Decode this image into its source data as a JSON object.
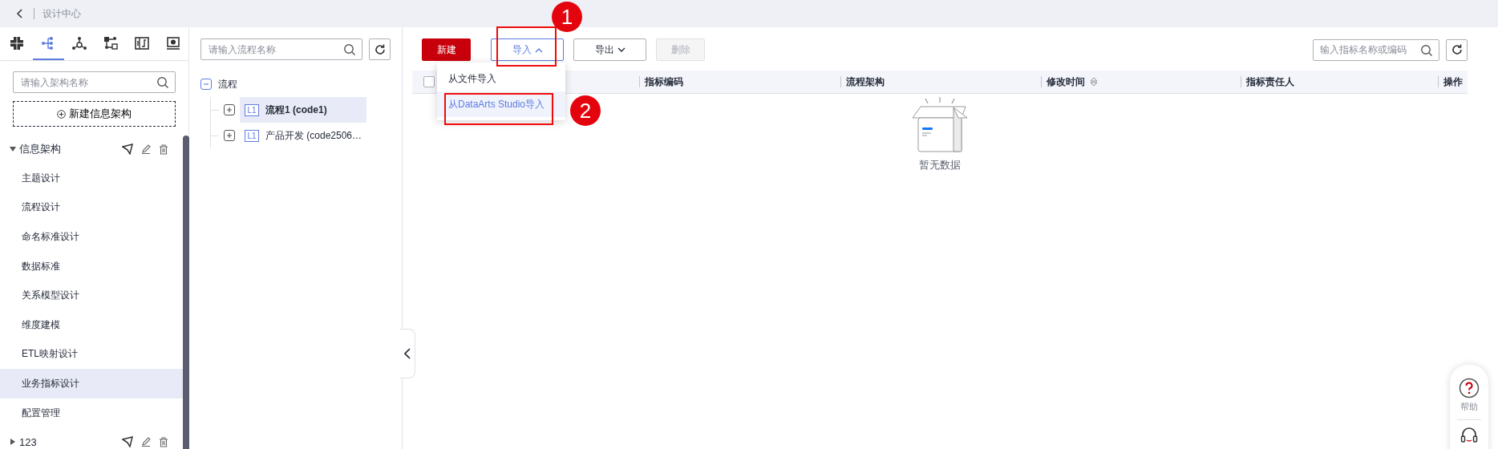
{
  "header": {
    "title": "设计中心"
  },
  "sidebar": {
    "tabs": [
      {
        "selected": false
      },
      {
        "selected": true
      },
      {
        "selected": false
      },
      {
        "selected": false
      },
      {
        "selected": false
      },
      {
        "selected": false
      }
    ],
    "search": {
      "placeholder": "请输入架构名称"
    },
    "new_button": "新建信息架构",
    "tree": [
      {
        "label": "信息架构",
        "expanded": true,
        "children": [
          {
            "label": "主题设计",
            "selected": false
          },
          {
            "label": "流程设计",
            "selected": false
          },
          {
            "label": "命名标准设计",
            "selected": false
          },
          {
            "label": "数据标准",
            "selected": false
          },
          {
            "label": "关系模型设计",
            "selected": false
          },
          {
            "label": "维度建模",
            "selected": false
          },
          {
            "label": "ETL映射设计",
            "selected": false
          },
          {
            "label": "业务指标设计",
            "selected": true
          },
          {
            "label": "配置管理",
            "selected": false
          }
        ]
      },
      {
        "label": "123",
        "expanded": false
      }
    ]
  },
  "process_panel": {
    "search": {
      "placeholder": "请输入流程名称"
    },
    "tree": {
      "label": "流程",
      "expanded": true,
      "children": [
        {
          "badge": "L1",
          "label": "流程1 (code1)",
          "selected": true,
          "expanded": false
        },
        {
          "badge": "L1",
          "label": "产品开发 (code2506…",
          "selected": false,
          "expanded": false
        }
      ]
    }
  },
  "toolbar": {
    "buttons": [
      {
        "kind": "primary",
        "label": "新建",
        "disabled": false
      },
      {
        "kind": "dropdown",
        "label": "导入",
        "disabled": false,
        "expanded": true
      },
      {
        "kind": "dropdown",
        "label": "导出",
        "disabled": false,
        "expanded": false
      },
      {
        "kind": "plain",
        "label": "删除",
        "disabled": true
      }
    ],
    "search": {
      "placeholder": "输入指标名称或编码"
    }
  },
  "dropdown_menu": {
    "items": [
      {
        "label": "从文件导入",
        "selected": false
      },
      {
        "label": "从DataArts Studio导入",
        "selected": true
      }
    ]
  },
  "table": {
    "select_all": {
      "checked": false
    },
    "columns": [
      {
        "label": "指标编码",
        "sortable": false
      },
      {
        "label": "流程架构",
        "sortable": false
      },
      {
        "label": "修改时间",
        "sortable": true
      },
      {
        "label": "指标责任人",
        "sortable": false
      },
      {
        "label": "操作",
        "sortable": false
      }
    ],
    "empty_text": "暂无数据"
  },
  "help": {
    "label": "帮助"
  },
  "annotations": [
    {
      "label": "1"
    },
    {
      "label": "2"
    }
  ]
}
